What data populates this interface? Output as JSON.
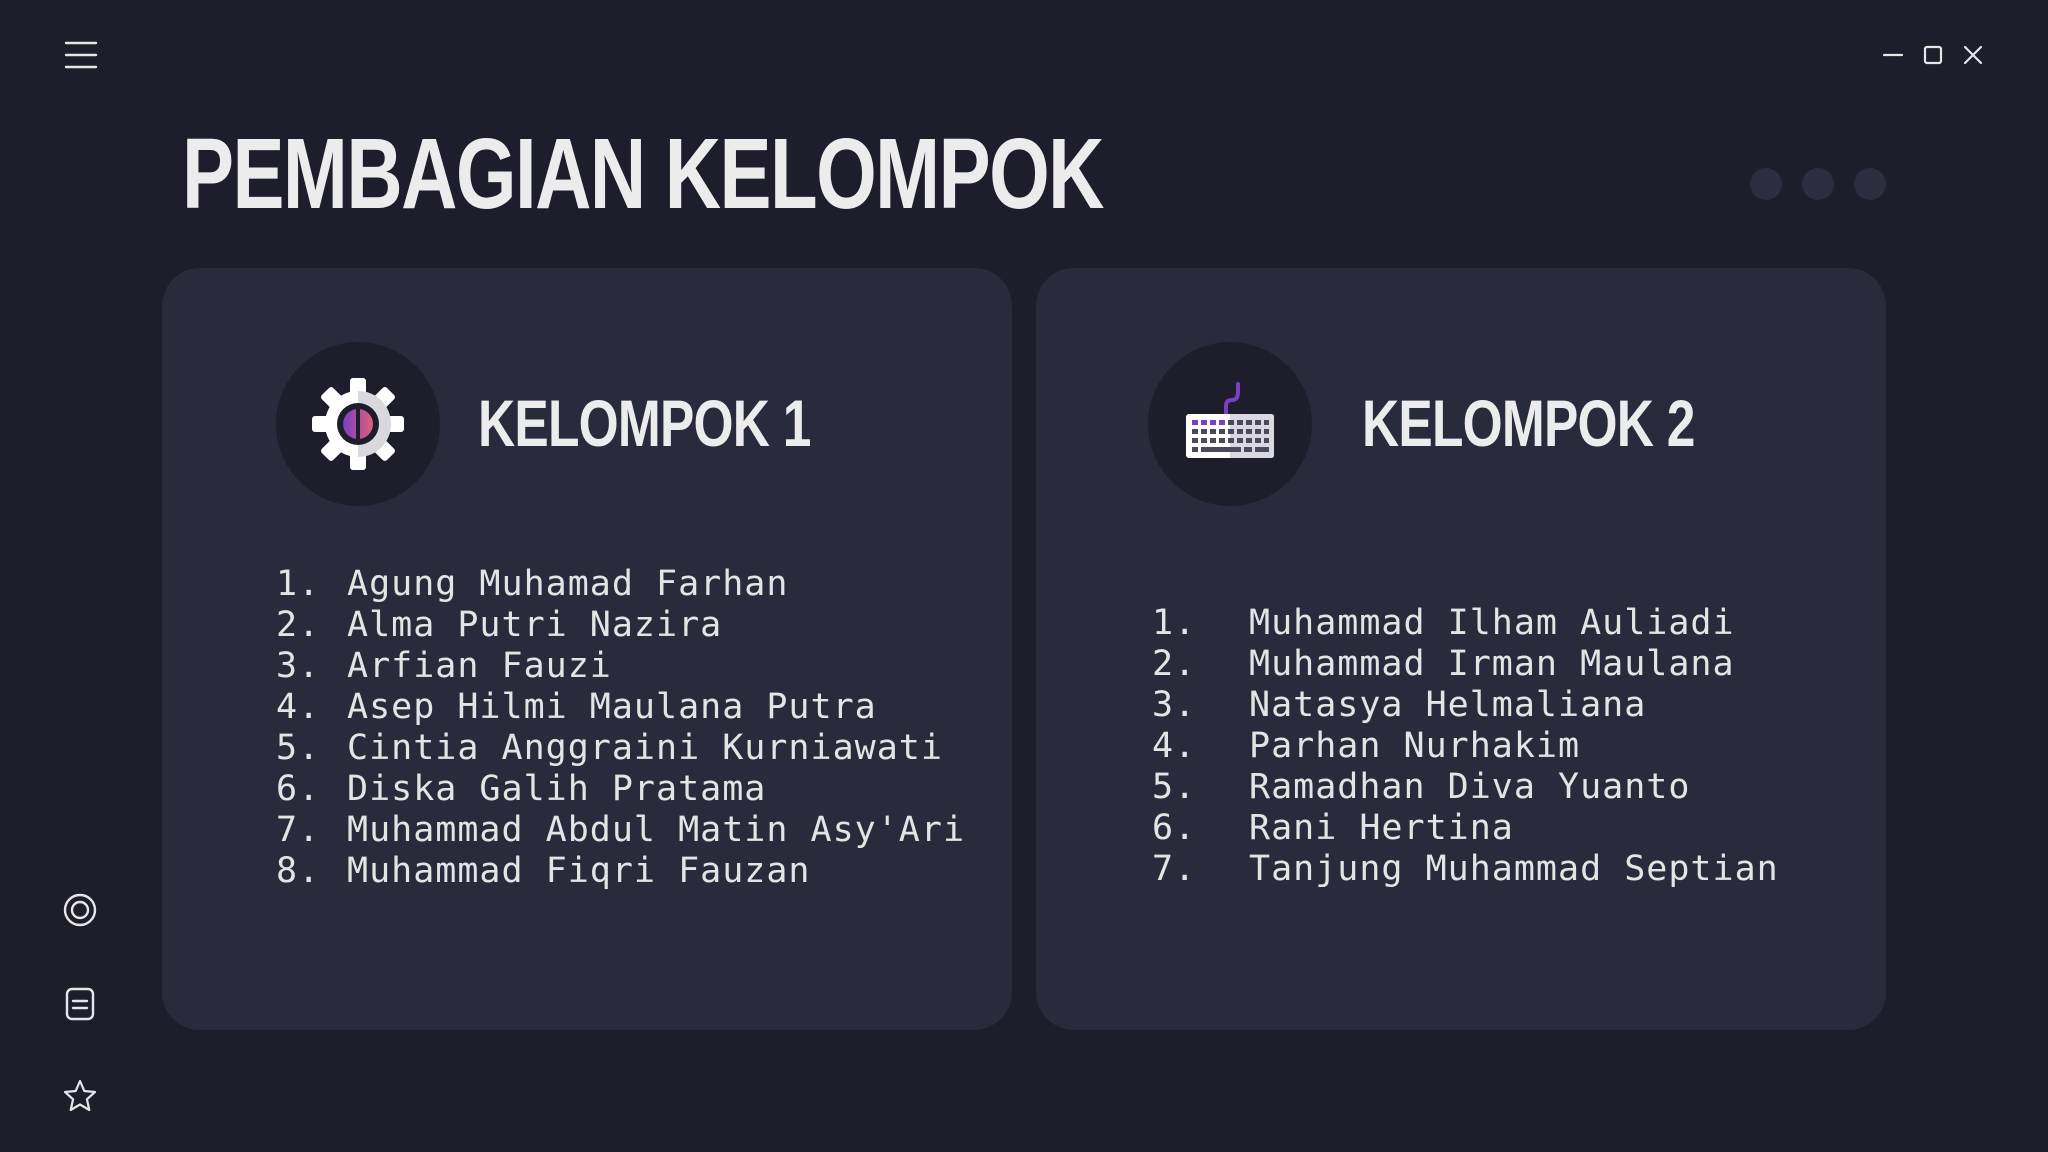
{
  "window": {
    "controls": [
      "minimize-icon",
      "maximize-icon",
      "close-icon"
    ]
  },
  "sidebar": {
    "menu_icon": "hamburger-menu-icon",
    "icons": [
      "target-icon",
      "document-icon",
      "star-icon"
    ]
  },
  "title": "PEMBAGIAN KELOMPOK",
  "pager": {
    "dots": 3
  },
  "colors": {
    "background": "#1d1d2b",
    "card": "#2a2a3d",
    "text": "#ececec",
    "accent_purple": "#7a3fc4",
    "accent_pink": "#e0607a"
  },
  "groups": [
    {
      "icon": "gear-icon",
      "title": "KELOMPOK 1",
      "members": [
        {
          "num": "1.",
          "name": "Agung Muhamad Farhan"
        },
        {
          "num": "2.",
          "name": "Alma Putri Nazira"
        },
        {
          "num": "3.",
          "name": "Arfian Fauzi"
        },
        {
          "num": "4.",
          "name": "Asep Hilmi Maulana Putra"
        },
        {
          "num": "5.",
          "name": "Cintia Anggraini Kurniawati"
        },
        {
          "num": "6.",
          "name": "Diska Galih Pratama"
        },
        {
          "num": "7.",
          "name": "Muhammad Abdul Matin Asy'Ari"
        },
        {
          "num": "8.",
          "name": "Muhammad Fiqri Fauzan"
        }
      ]
    },
    {
      "icon": "keyboard-icon",
      "title": "KELOMPOK 2",
      "members": [
        {
          "num": "1.",
          "name": "Muhammad Ilham Auliadi"
        },
        {
          "num": "2.",
          "name": "Muhammad Irman Maulana"
        },
        {
          "num": "3.",
          "name": "Natasya Helmaliana"
        },
        {
          "num": "4.",
          "name": "Parhan Nurhakim"
        },
        {
          "num": "5.",
          "name": "Ramadhan Diva Yuanto"
        },
        {
          "num": "6.",
          "name": "Rani Hertina"
        },
        {
          "num": "7.",
          "name": "Tanjung Muhammad Septian"
        }
      ]
    }
  ]
}
